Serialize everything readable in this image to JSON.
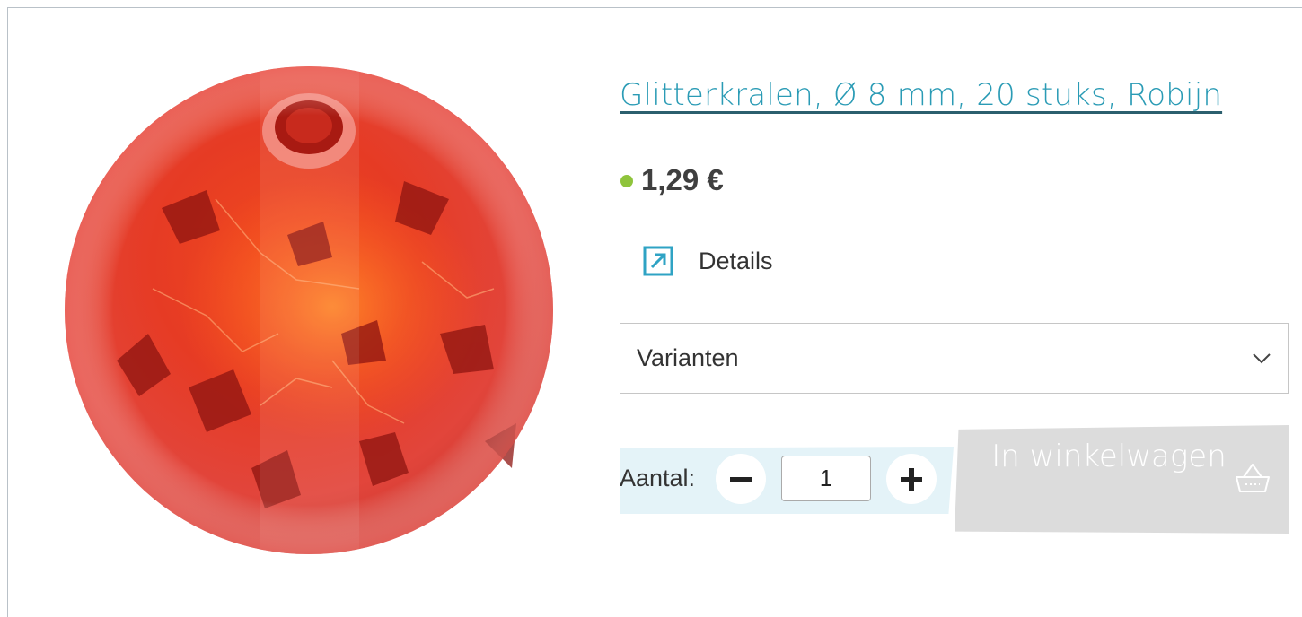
{
  "product": {
    "title": "Glitterkralen, Ø 8 mm, 20 stuks, Robijn",
    "price": "1,29 €",
    "availability_color": "#8fc43c",
    "image_subject": "red crackle glass bead"
  },
  "details": {
    "label": "Details",
    "icon": "external-link-icon"
  },
  "variants": {
    "label": "Varianten",
    "icon": "chevron-down-icon"
  },
  "quantity": {
    "label": "Aantal:",
    "value": "1",
    "minus_icon": "minus-icon",
    "plus_icon": "plus-icon"
  },
  "cart": {
    "label": "In winkelwagen",
    "icon": "basket-icon"
  },
  "colors": {
    "accent": "#2a9bb5",
    "cart_disabled": "#dcdcdc",
    "qty_band": "#e4f3f8"
  }
}
